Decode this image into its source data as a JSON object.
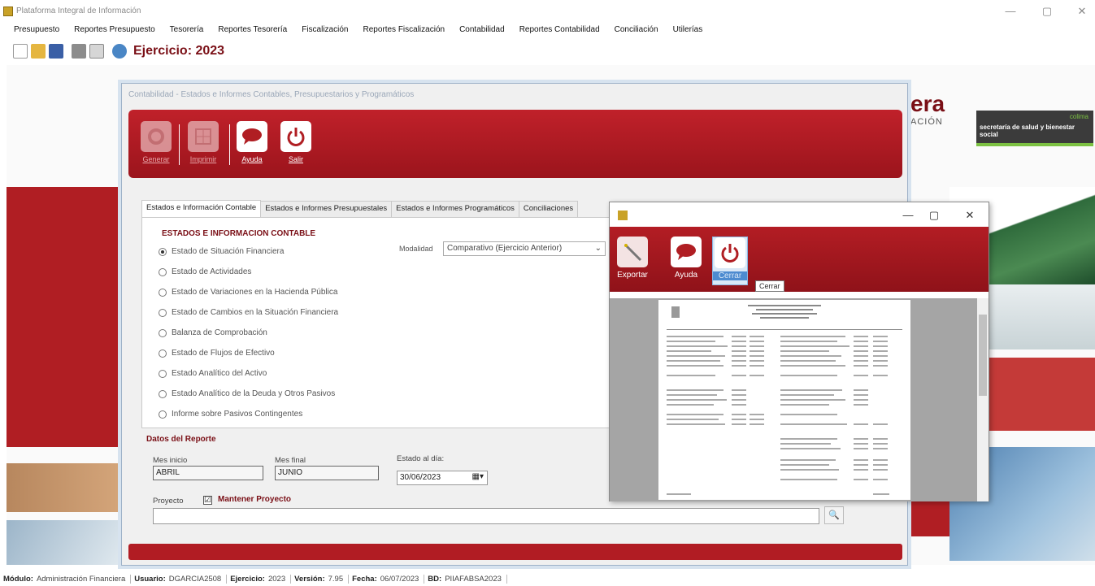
{
  "window": {
    "title": "Plataforma Integral de Información",
    "minimize": "—",
    "maximize": "▢",
    "close": "✕"
  },
  "menu": [
    "Presupuesto",
    "Reportes Presupuesto",
    "Tesorería",
    "Reportes Tesorería",
    "Fiscalización",
    "Reportes Fiscalización",
    "Contabilidad",
    "Reportes Contabilidad",
    "Conciliación",
    "Utilerías"
  ],
  "toolbar": {
    "ejercicio": "Ejercicio: 2023"
  },
  "background": {
    "brand": "era",
    "brand_sub": "ACIÓN",
    "logo_text": "secretaría de salud y bienestar social",
    "logo_brand": "colima"
  },
  "dialog": {
    "title": "Contabilidad - Estados e Informes Contables, Presupuestarios y Programáticos",
    "buttons": {
      "generar": "Generar",
      "imprimir": "Imprimir",
      "ayuda": "Ayuda",
      "salir": "Salir"
    },
    "tabs": [
      "Estados e Información Contable",
      "Estados e Informes Presupuestales",
      "Estados e Informes Programáticos",
      "Conciliaciones"
    ],
    "section_title": "ESTADOS E INFORMACION CONTABLE",
    "options": [
      {
        "label": "Estado de Situación Financiera",
        "selected": true
      },
      {
        "label": "Estado de Actividades",
        "selected": false
      },
      {
        "label": "Estado de Variaciones en la Hacienda Pública",
        "selected": false
      },
      {
        "label": "Estado de Cambios en la Situación Financiera",
        "selected": false
      },
      {
        "label": "Balanza de Comprobación",
        "selected": false
      },
      {
        "label": "Estado de Flujos de Efectivo",
        "selected": false
      },
      {
        "label": "Estado Analítico del Activo",
        "selected": false
      },
      {
        "label": "Estado Analítico de la Deuda y Otros Pasivos",
        "selected": false
      },
      {
        "label": "Informe sobre Pasivos Contingentes",
        "selected": false
      }
    ],
    "modalidad_label": "Modalidad",
    "modalidad_value": "Comparativo (Ejercicio Anterior)",
    "datos_title": "Datos del Reporte",
    "mes_inicio_label": "Mes inicio",
    "mes_inicio_value": "ABRIL",
    "mes_final_label": "Mes final",
    "mes_final_value": "JUNIO",
    "estado_dia_label": "Estado al día:",
    "estado_dia_value": "30/06/2023",
    "proyecto_label": "Proyecto",
    "mantener_label": "Mantener Proyecto",
    "mantener_checked": "☑"
  },
  "preview": {
    "buttons": {
      "exportar": "Exportar",
      "ayuda": "Ayuda",
      "cerrar": "Cerrar"
    },
    "tooltip": "Cerrar"
  },
  "status": {
    "modulo_label": "Módulo:",
    "modulo_value": "Administración Financiera",
    "usuario_label": "Usuario:",
    "usuario_value": "DGARCIA2508",
    "ejercicio_label": "Ejercicio:",
    "ejercicio_value": "2023",
    "version_label": "Versión:",
    "version_value": "7.95",
    "fecha_label": "Fecha:",
    "fecha_value": "06/07/2023",
    "bd_label": "BD:",
    "bd_value": "PIIAFABSA2023"
  },
  "colors": {
    "accent": "#b01e23",
    "dark_accent": "#7a0f16"
  }
}
